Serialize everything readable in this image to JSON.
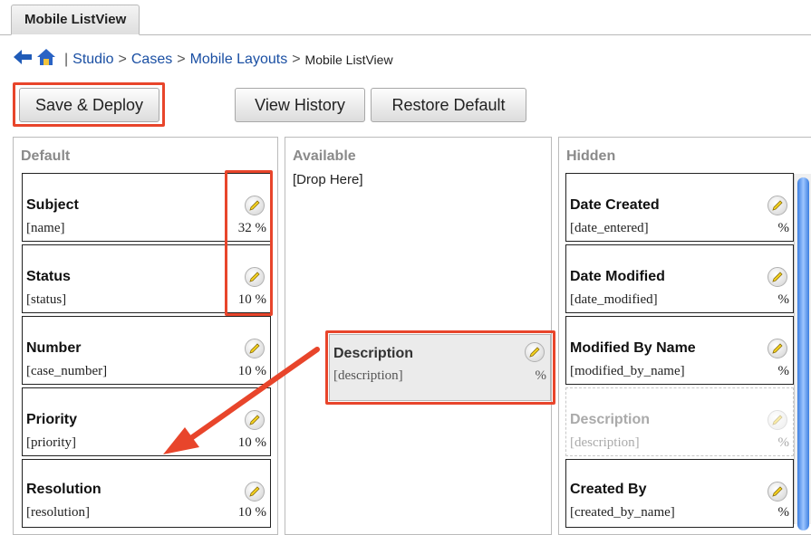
{
  "tab": {
    "label": "Mobile ListView"
  },
  "breadcrumb": {
    "items": [
      "Studio",
      "Cases",
      "Mobile Layouts"
    ],
    "current": "Mobile ListView",
    "pipe": "|",
    "separator": ">"
  },
  "toolbar": {
    "save_deploy": "Save & Deploy",
    "view_history": "View History",
    "restore_default": "Restore Default"
  },
  "columns": {
    "default": {
      "heading": "Default",
      "fields": [
        {
          "label": "Subject",
          "name": "[name]",
          "width": "32 %"
        },
        {
          "label": "Status",
          "name": "[status]",
          "width": "10 %"
        },
        {
          "label": "Number",
          "name": "[case_number]",
          "width": "10 %"
        },
        {
          "label": "Priority",
          "name": "[priority]",
          "width": "10 %"
        },
        {
          "label": "Resolution",
          "name": "[resolution]",
          "width": "10 %"
        }
      ]
    },
    "available": {
      "heading": "Available",
      "drop_here": "[Drop Here]",
      "dragged": {
        "label": "Description",
        "name": "[description]",
        "width": "%"
      }
    },
    "hidden": {
      "heading": "Hidden",
      "fields": [
        {
          "label": "Date Created",
          "name": "[date_entered]",
          "width": "%"
        },
        {
          "label": "Date Modified",
          "name": "[date_modified]",
          "width": "%"
        },
        {
          "label": "Modified By Name",
          "name": "[modified_by_name]",
          "width": "%"
        },
        {
          "label": "Description",
          "name": "[description]",
          "width": "%"
        },
        {
          "label": "Created By",
          "name": "[created_by_name]",
          "width": "%"
        }
      ]
    }
  },
  "colors": {
    "highlight": "#e8452b",
    "link": "#1a4fa3",
    "column_heading": "#8a8a8a"
  }
}
